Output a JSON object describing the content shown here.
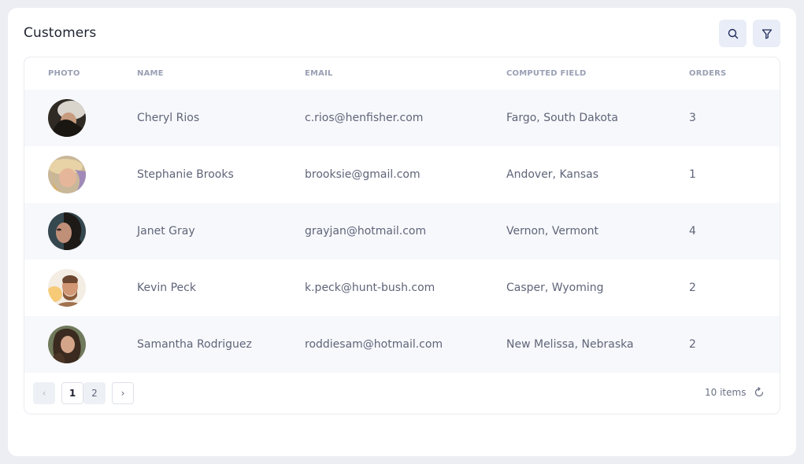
{
  "header": {
    "title": "Customers"
  },
  "toolbar": {
    "search_icon": "search-icon",
    "filter_icon": "filter-icon"
  },
  "table": {
    "columns": [
      "PHOTO",
      "NAME",
      "EMAIL",
      "COMPUTED FIELD",
      "ORDERS"
    ],
    "rows": [
      {
        "name": "Cheryl Rios",
        "email": "c.rios@henfisher.com",
        "computed": "Fargo, South Dakota",
        "orders": "3"
      },
      {
        "name": "Stephanie Brooks",
        "email": "brooksie@gmail.com",
        "computed": "Andover, Kansas",
        "orders": "1"
      },
      {
        "name": "Janet Gray",
        "email": "grayjan@hotmail.com",
        "computed": "Vernon, Vermont",
        "orders": "4"
      },
      {
        "name": "Kevin Peck",
        "email": "k.peck@hunt-bush.com",
        "computed": "Casper, Wyoming",
        "orders": "2"
      },
      {
        "name": "Samantha Rodriguez",
        "email": "roddiesam@hotmail.com",
        "computed": "New Melissa, Nebraska",
        "orders": "2"
      }
    ]
  },
  "pagination": {
    "prev": "‹",
    "pages": [
      "1",
      "2"
    ],
    "current_page": "1",
    "next": "›",
    "items_count": "10 items"
  },
  "colors": {
    "accent": "#1e3a8a",
    "row_alt": "#f7f8fb"
  }
}
